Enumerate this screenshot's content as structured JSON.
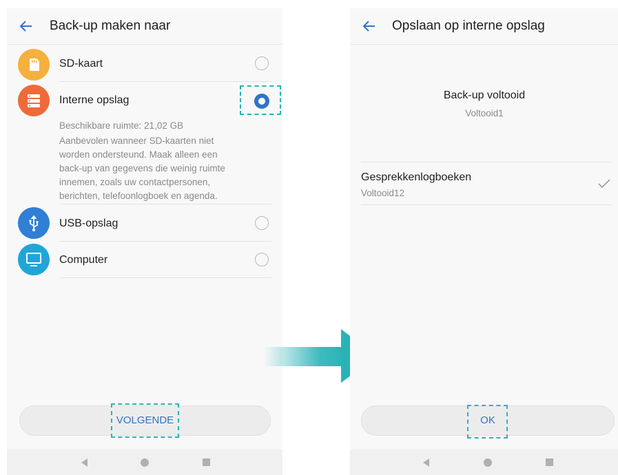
{
  "left": {
    "title": "Back-up maken naar",
    "options": [
      {
        "label": "SD-kaart",
        "icon": "sd-card-icon",
        "color": "#f5b03d",
        "selected": false
      },
      {
        "label": "Interne opslag",
        "icon": "storage-icon",
        "color": "#ef6a3a",
        "selected": true
      },
      {
        "label": "USB-opslag",
        "icon": "usb-icon",
        "color": "#2f7fd6",
        "selected": false
      },
      {
        "label": "Computer",
        "icon": "computer-icon",
        "color": "#1fa6d8",
        "selected": false
      }
    ],
    "available_space": "Beschikbare ruimte: 21,02 GB",
    "description_lines": [
      "Aanbevolen wanneer SD-kaarten niet",
      "worden ondersteund. Maak alleen een",
      "back-up van gegevens die weinig ruimte",
      "innemen, zoals uw contactpersonen,",
      "berichten, telefoonlogboek en agenda."
    ],
    "next_button": "VOLGENDE"
  },
  "right": {
    "title": "Opslaan op interne opslag",
    "status_title": "Back-up voltooid",
    "status_sub": "Voltooid1",
    "item_title": "Gesprekkenlogboeken",
    "item_sub": "Voltooid12",
    "ok_button": "OK"
  },
  "colors": {
    "accent": "#3273c7",
    "highlight": "#2ab3b7"
  }
}
